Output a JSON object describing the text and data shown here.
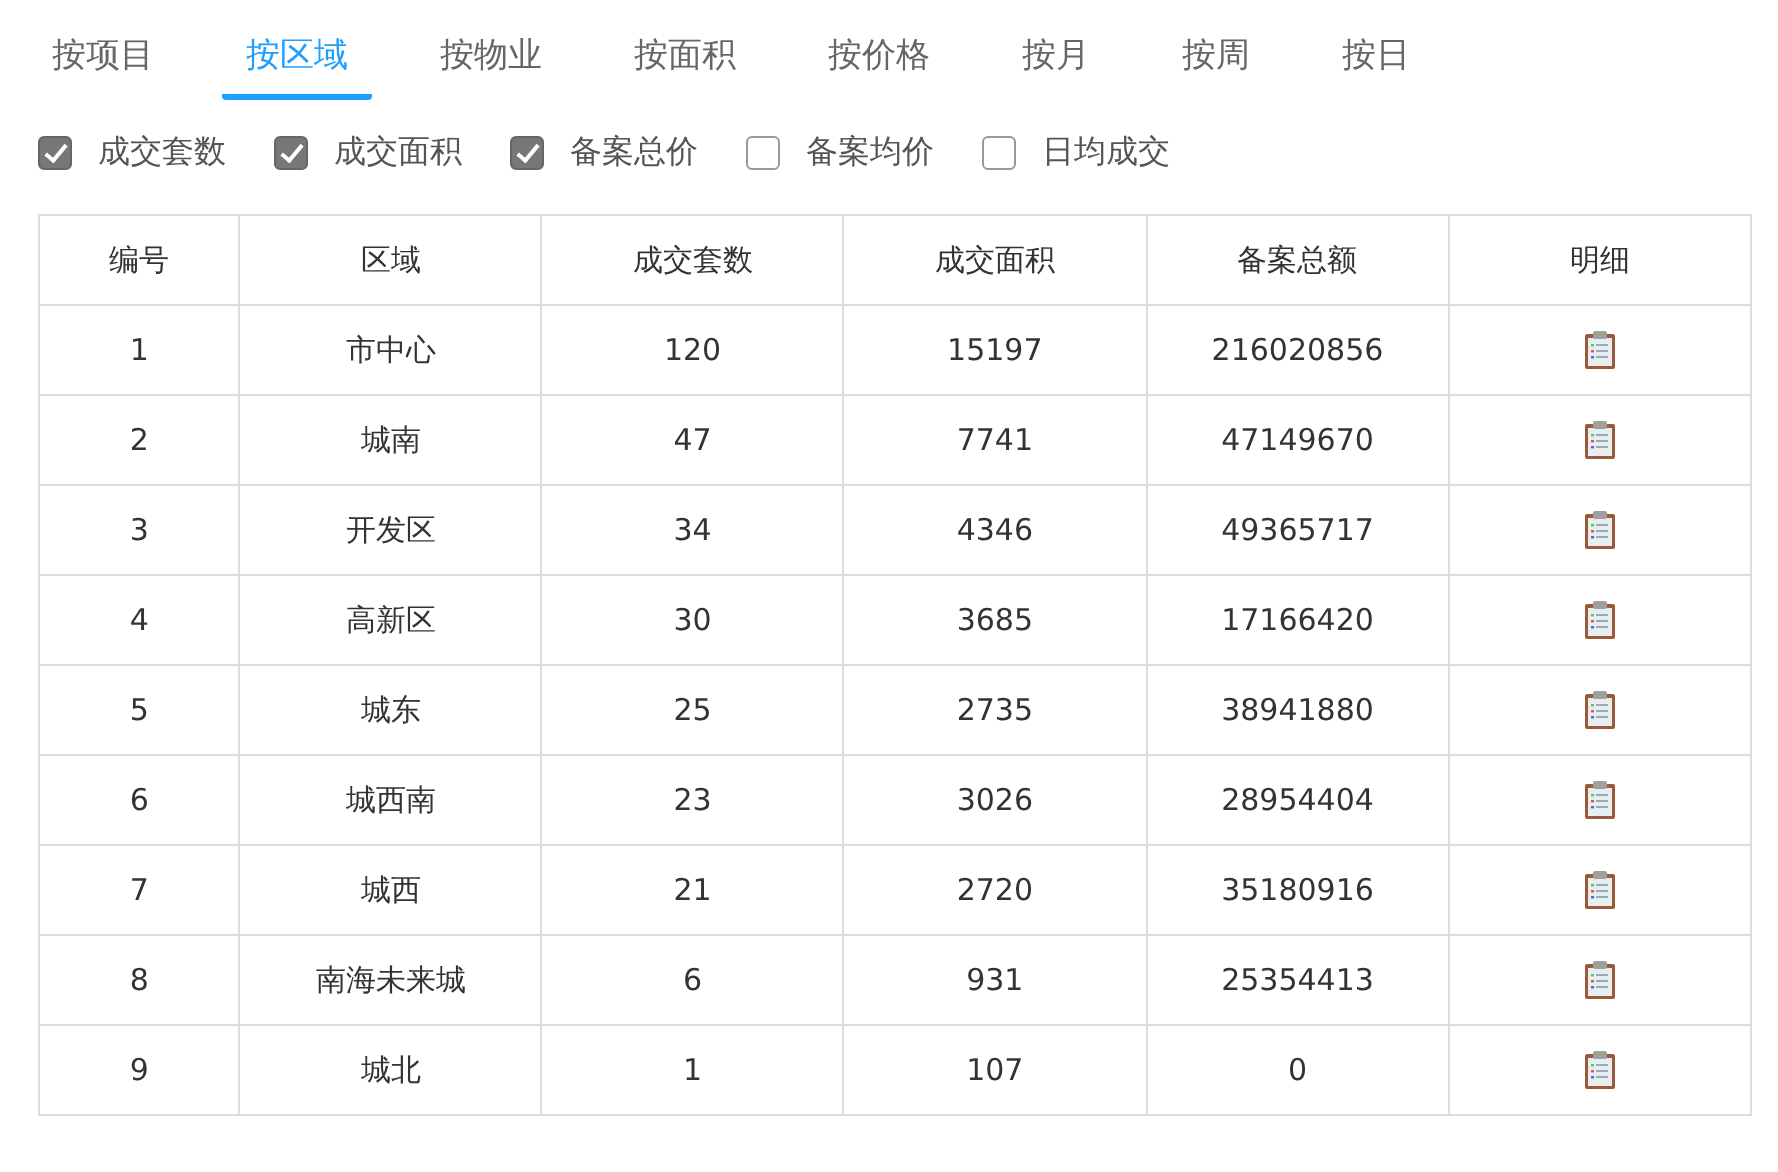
{
  "tabs": [
    {
      "label": "按项目",
      "selected": false
    },
    {
      "label": "按区域",
      "selected": true
    },
    {
      "label": "按物业",
      "selected": false
    },
    {
      "label": "按面积",
      "selected": false
    },
    {
      "label": "按价格",
      "selected": false
    },
    {
      "label": "按月",
      "selected": false
    },
    {
      "label": "按周",
      "selected": false
    },
    {
      "label": "按日",
      "selected": false
    }
  ],
  "options": [
    {
      "label": "成交套数",
      "checked": true
    },
    {
      "label": "成交面积",
      "checked": true
    },
    {
      "label": "备案总价",
      "checked": true
    },
    {
      "label": "备案均价",
      "checked": false
    },
    {
      "label": "日均成交",
      "checked": false
    }
  ],
  "table": {
    "columns": [
      "编号",
      "区域",
      "成交套数",
      "成交面积",
      "备案总额",
      "明细"
    ],
    "rows": [
      [
        "1",
        "市中心",
        "120",
        "15197",
        "216020856"
      ],
      [
        "2",
        "城南",
        "47",
        "7741",
        "47149670"
      ],
      [
        "3",
        "开发区",
        "34",
        "4346",
        "49365717"
      ],
      [
        "4",
        "高新区",
        "30",
        "3685",
        "17166420"
      ],
      [
        "5",
        "城东",
        "25",
        "2735",
        "38941880"
      ],
      [
        "6",
        "城西南",
        "23",
        "3026",
        "28954404"
      ],
      [
        "7",
        "城西",
        "21",
        "2720",
        "35180916"
      ],
      [
        "8",
        "南海未来城",
        "6",
        "931",
        "25354413"
      ],
      [
        "9",
        "城北",
        "1",
        "107",
        "0"
      ]
    ]
  }
}
